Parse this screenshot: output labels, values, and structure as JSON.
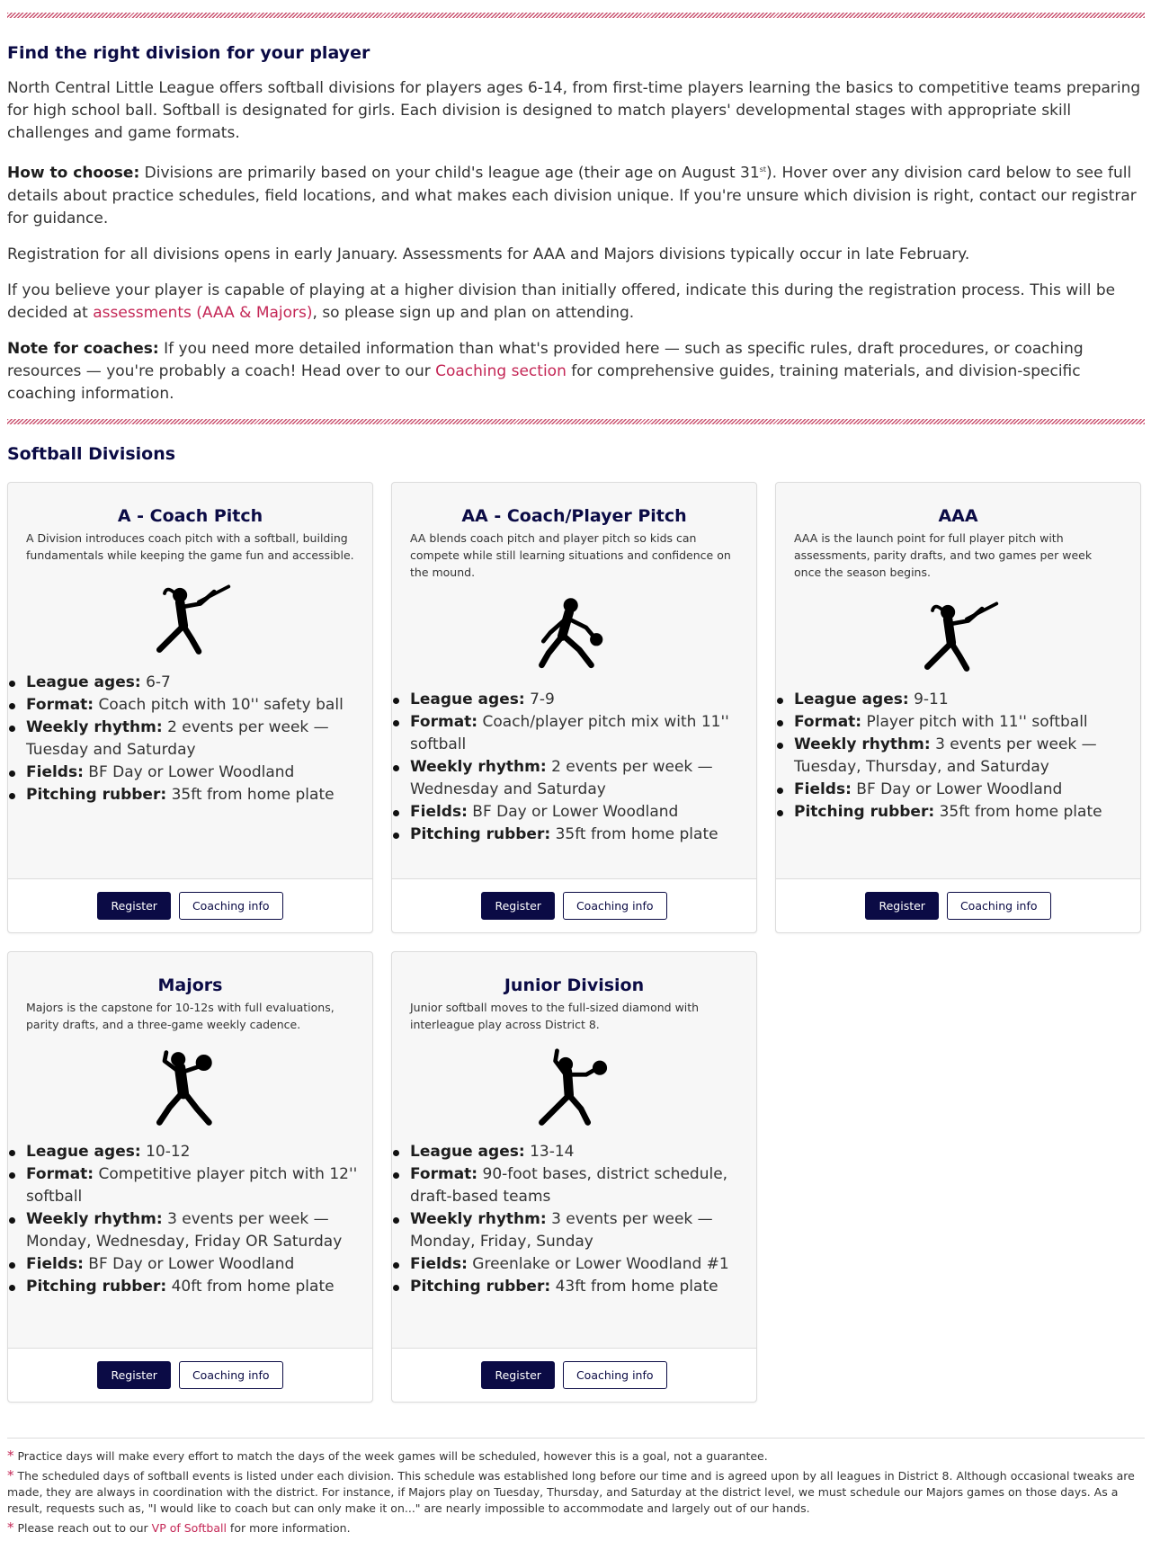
{
  "intro": {
    "title": "Find the right division for your player",
    "p1": "North Central Little League offers softball divisions for players ages 6-14, from first-time players learning the basics to competitive teams preparing for high school ball. Softball is designated for girls. Each division is designed to match players' developmental stages with appropriate skill challenges and game formats.",
    "p2_label": "How to choose:",
    "p2_before": " Divisions are primarily based on your child's league age (their age on August 31",
    "p2_sup": "st",
    "p2_after": "). Hover over any division card below to see full details about practice schedules, field locations, and what makes each division unique. If you're unsure which division is right, contact our registrar for guidance.",
    "p3": "Registration for all divisions opens in early January. Assessments for AAA and Majors divisions typically occur in late February.",
    "p4_before": "If you believe your player is capable of playing at a higher division than initially offered, indicate this during the registration process. This will be decided at ",
    "p4_link": "assessments (AAA & Majors)",
    "p4_after": ", so please sign up and plan on attending.",
    "p5_label": "Note for coaches:",
    "p5_before": " If you need more detailed information than what's provided here — such as specific rules, draft procedures, or coaching resources — you're probably a coach! Head over to our ",
    "p5_link": "Coaching section",
    "p5_after": " for comprehensive guides, training materials, and division-specific coaching information."
  },
  "divisions_title": "Softball Divisions",
  "labels": {
    "ages": "League ages:",
    "format": "Format:",
    "rhythm": "Weekly rhythm:",
    "fields": "Fields:",
    "rubber": "Pitching rubber:",
    "register": "Register",
    "coaching": "Coaching info"
  },
  "cards": [
    {
      "title": "A - Coach Pitch",
      "desc": "A Division introduces coach pitch with a softball, building fundamentals while keeping the game fun and accessible.",
      "icon": "batter-silhouette-icon",
      "ages": "6-7",
      "format": "Coach pitch with 10'' safety ball",
      "rhythm": "2 events per week — Tuesday and Saturday",
      "fields": "BF Day or Lower Woodland",
      "rubber": "35ft from home plate"
    },
    {
      "title": "AA - Coach/Player Pitch",
      "desc": "AA blends coach pitch and player pitch so kids can compete while still learning situations and confidence on the mound.",
      "icon": "pitcher-silhouette-icon",
      "ages": "7-9",
      "format": "Coach/player pitch mix with 11'' softball",
      "rhythm": "2 events per week — Wednesday and Saturday",
      "fields": "BF Day or Lower Woodland",
      "rubber": "35ft from home plate"
    },
    {
      "title": "AAA",
      "desc": "AAA is the launch point for full player pitch with assessments, parity drafts, and two games per week once the season begins.",
      "icon": "batter-silhouette-icon",
      "ages": "9-11",
      "format": "Player pitch with 11'' softball",
      "rhythm": "3 events per week — Tuesday, Thursday, and Saturday",
      "fields": "BF Day or Lower Woodland",
      "rubber": "35ft from home plate"
    },
    {
      "title": "Majors",
      "desc": "Majors is the capstone for 10-12s with full evaluations, parity drafts, and a three-game weekly cadence.",
      "icon": "catcher-silhouette-icon",
      "ages": "10-12",
      "format": "Competitive player pitch with 12'' softball",
      "rhythm": "3 events per week — Monday, Wednesday, Friday OR Saturday",
      "fields": "BF Day or Lower Woodland",
      "rubber": "40ft from home plate"
    },
    {
      "title": "Junior Division",
      "desc": "Junior softball moves to the full-sized diamond with interleague play across District 8.",
      "icon": "fielder-silhouette-icon",
      "ages": "13-14",
      "format": "90-foot bases, district schedule, draft-based teams",
      "rhythm": "3 events per week — Monday, Friday, Sunday",
      "fields": "Greenlake or Lower Woodland #1",
      "rubber": "43ft from home plate"
    }
  ],
  "notes": {
    "star": "*",
    "n1": "Practice days will make every effort to match the days of the week games will be scheduled, however this is a goal, not a guarantee.",
    "n2": "The scheduled days of softball events is listed under each division. This schedule was established long before our time and is agreed upon by all leagues in District 8. Although occasional tweaks are made, they are always in coordination with the district. For instance, if Majors play on Tuesday, Thursday, and Saturday at the district level, we must schedule our Majors games on those days. As a result, requests such as, \"I would like to coach but can only make it on...\" are nearly impossible to accommodate and largely out of our hands.",
    "n3_before": "Please reach out to our ",
    "n3_link": "VP of Softball",
    "n3_after": " for more information."
  }
}
